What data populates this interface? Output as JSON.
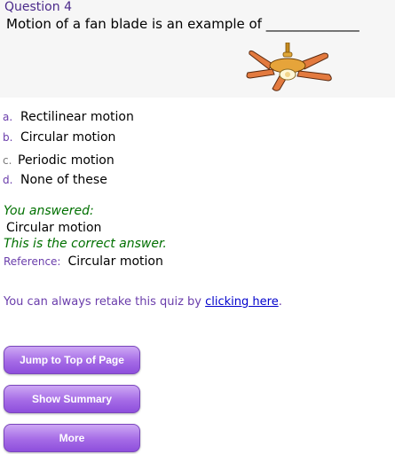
{
  "question": {
    "title": "Question 4",
    "text": "Motion of a fan blade is an example of ______________"
  },
  "options": [
    {
      "letter": "a.",
      "text": "Rectilinear motion"
    },
    {
      "letter": "b.",
      "text": "Circular motion"
    },
    {
      "letter": "c.",
      "text": "Periodic motion"
    },
    {
      "letter": "d.",
      "text": "None of these"
    }
  ],
  "result": {
    "answered_label": "You answered:",
    "answered_value": "Circular motion",
    "correct_message": "This is the correct answer.",
    "reference_label": "Reference:",
    "reference_value": "Circular motion"
  },
  "retake": {
    "prefix": "You can always retake this quiz by ",
    "link_text": "clicking here",
    "suffix": "."
  },
  "buttons": {
    "top": "Jump to Top of Page",
    "summary": "Show Summary",
    "more": "More"
  },
  "colors": {
    "accent": "#6a3dab",
    "correct": "#007000",
    "button": "#a56be6"
  }
}
